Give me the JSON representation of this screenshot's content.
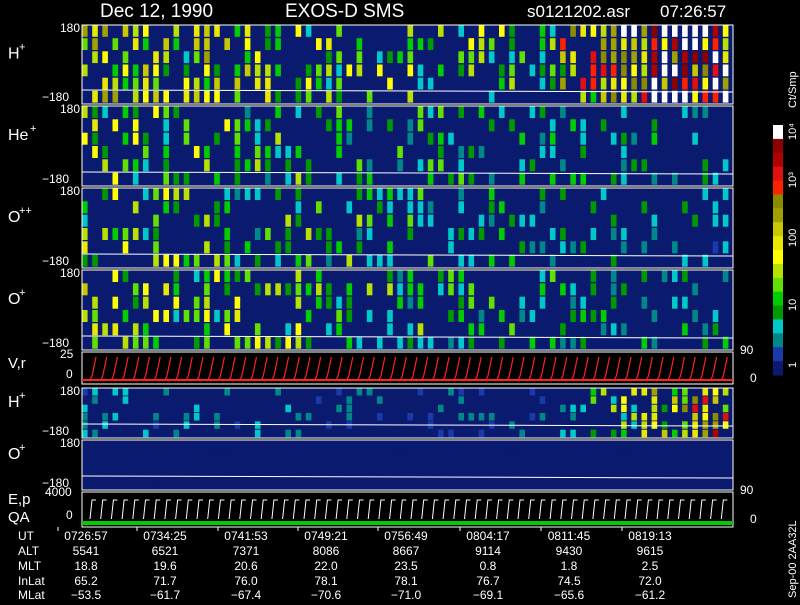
{
  "header": {
    "date": "Dec 12, 1990",
    "mission": "EXOS-D SMS",
    "filename": "s0121202.asr",
    "time": "07:26:57"
  },
  "panels": [
    {
      "id": "h-plus",
      "label": "H",
      "sup": "+",
      "ymax": "180",
      "ymin": "−180",
      "fill": 0.55,
      "bright": "end"
    },
    {
      "id": "he-plus",
      "label": "He",
      "sup": "+",
      "ymax": "180",
      "ymin": "−180",
      "fill": 0.4,
      "bright": "none"
    },
    {
      "id": "o-pp",
      "label": "O",
      "sup": "++",
      "ymax": "180",
      "ymin": "−180",
      "fill": 0.4,
      "bright": "none"
    },
    {
      "id": "o-plus",
      "label": "O",
      "sup": "+",
      "ymax": "180",
      "ymin": "−180",
      "fill": 0.45,
      "bright": "none"
    },
    {
      "id": "h-plus-2",
      "label": "H",
      "sup": "+",
      "ymax": "180",
      "ymin": "−180",
      "fill": 0.15,
      "bright": "end"
    },
    {
      "id": "o-plus-2",
      "label": "O",
      "sup": "+",
      "ymax": "180",
      "ymin": "−180",
      "fill": 0.02,
      "bright": "none"
    }
  ],
  "vr_panel": {
    "label": "V,r",
    "ymax": "25",
    "ymin": "0",
    "right_top": "90",
    "right_bottom": "0"
  },
  "ep_panel": {
    "label1": "E,p",
    "label2": "QA",
    "ymax": "4000",
    "ymin": "0",
    "right_top": "90",
    "right_bottom": "0"
  },
  "colorbar": {
    "unit": "Ct/Smp",
    "ticks": [
      "10⁴",
      "10³",
      "100",
      "10",
      "1"
    ],
    "colors": [
      "#ffffff",
      "#8b0000",
      "#b00000",
      "#e01010",
      "#ff2000",
      "#8b8b00",
      "#a0a000",
      "#c8c800",
      "#e8e800",
      "#ffff00",
      "#b8e000",
      "#60e000",
      "#00cc00",
      "#009900",
      "#00c8c8",
      "#008888",
      "#1a3aaa",
      "#0a1a6e"
    ]
  },
  "footer": {
    "row_labels": [
      "UT",
      "ALT",
      "MLT",
      "InLat",
      "MLat"
    ],
    "columns": [
      [
        "0726:57",
        "5541",
        "18.8",
        "65.2",
        "−53.5"
      ],
      [
        "0734:25",
        "6521",
        "19.6",
        "71.7",
        "−61.7"
      ],
      [
        "0741:53",
        "7371",
        "20.6",
        "76.0",
        "−67.4"
      ],
      [
        "0749:21",
        "8086",
        "22.0",
        "78.1",
        "−70.6"
      ],
      [
        "0756:49",
        "8667",
        "23.5",
        "78.1",
        "−71.0"
      ],
      [
        "0804:17",
        "9114",
        "0.8",
        "76.7",
        "−69.1"
      ],
      [
        "0811:45",
        "9430",
        "1.8",
        "74.5",
        "−65.6"
      ],
      [
        "0819:13",
        "9615",
        "2.5",
        "72.0",
        "−61.2"
      ]
    ],
    "credit": "Sep-00  2AA32L"
  },
  "chart_data": {
    "type": "heatmap",
    "title": "Dec 12, 1990   EXOS-D SMS",
    "x_ticks": [
      "0726:57",
      "0734:25",
      "0741:53",
      "0749:21",
      "0756:49",
      "0804:17",
      "0811:45",
      "0819:13"
    ],
    "series": [
      {
        "name": "H+",
        "ylim": [
          -180,
          180
        ]
      },
      {
        "name": "He+",
        "ylim": [
          -180,
          180
        ]
      },
      {
        "name": "O++",
        "ylim": [
          -180,
          180
        ]
      },
      {
        "name": "O+",
        "ylim": [
          -180,
          180
        ]
      },
      {
        "name": "V,r",
        "ylim": [
          0,
          25
        ]
      },
      {
        "name": "H+",
        "ylim": [
          -180,
          180
        ]
      },
      {
        "name": "O+",
        "ylim": [
          -180,
          180
        ]
      },
      {
        "name": "E,p",
        "ylim": [
          0,
          4000
        ]
      }
    ],
    "colorbar": {
      "label": "Ct/Smp",
      "scale": "log",
      "range": [
        1,
        10000
      ]
    }
  }
}
